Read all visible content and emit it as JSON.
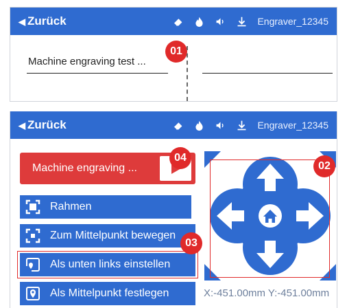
{
  "topbar": {
    "back_label": "Zurück",
    "device_name": "Engraver_12345",
    "icons": [
      "eraser-icon",
      "flame-icon",
      "sound-icon",
      "download-icon"
    ]
  },
  "top_panel": {
    "file_name": "Machine engraving test ...",
    "badge": "01"
  },
  "bottom_panel": {
    "engrave_button_label": "Machine engraving ...",
    "buttons": [
      {
        "label": "Rahmen",
        "icon": "frame-icon"
      },
      {
        "label": "Zum Mittelpunkt bewegen",
        "icon": "center-move-icon"
      },
      {
        "label": "Als unten links einstellen",
        "icon": "bottom-left-pin-icon"
      },
      {
        "label": "Als Mittelpunkt festlegen",
        "icon": "center-pin-icon"
      }
    ],
    "badges": {
      "joystick": "02",
      "bottom_left": "03",
      "engrave": "04"
    },
    "coordinates": "X:-451.00mm Y:-451.00mm"
  },
  "colors": {
    "primary": "#2f6bd0",
    "accent_red": "#de3b3b",
    "badge_red": "#e02a2a",
    "coord_text": "#6d7f9c"
  }
}
